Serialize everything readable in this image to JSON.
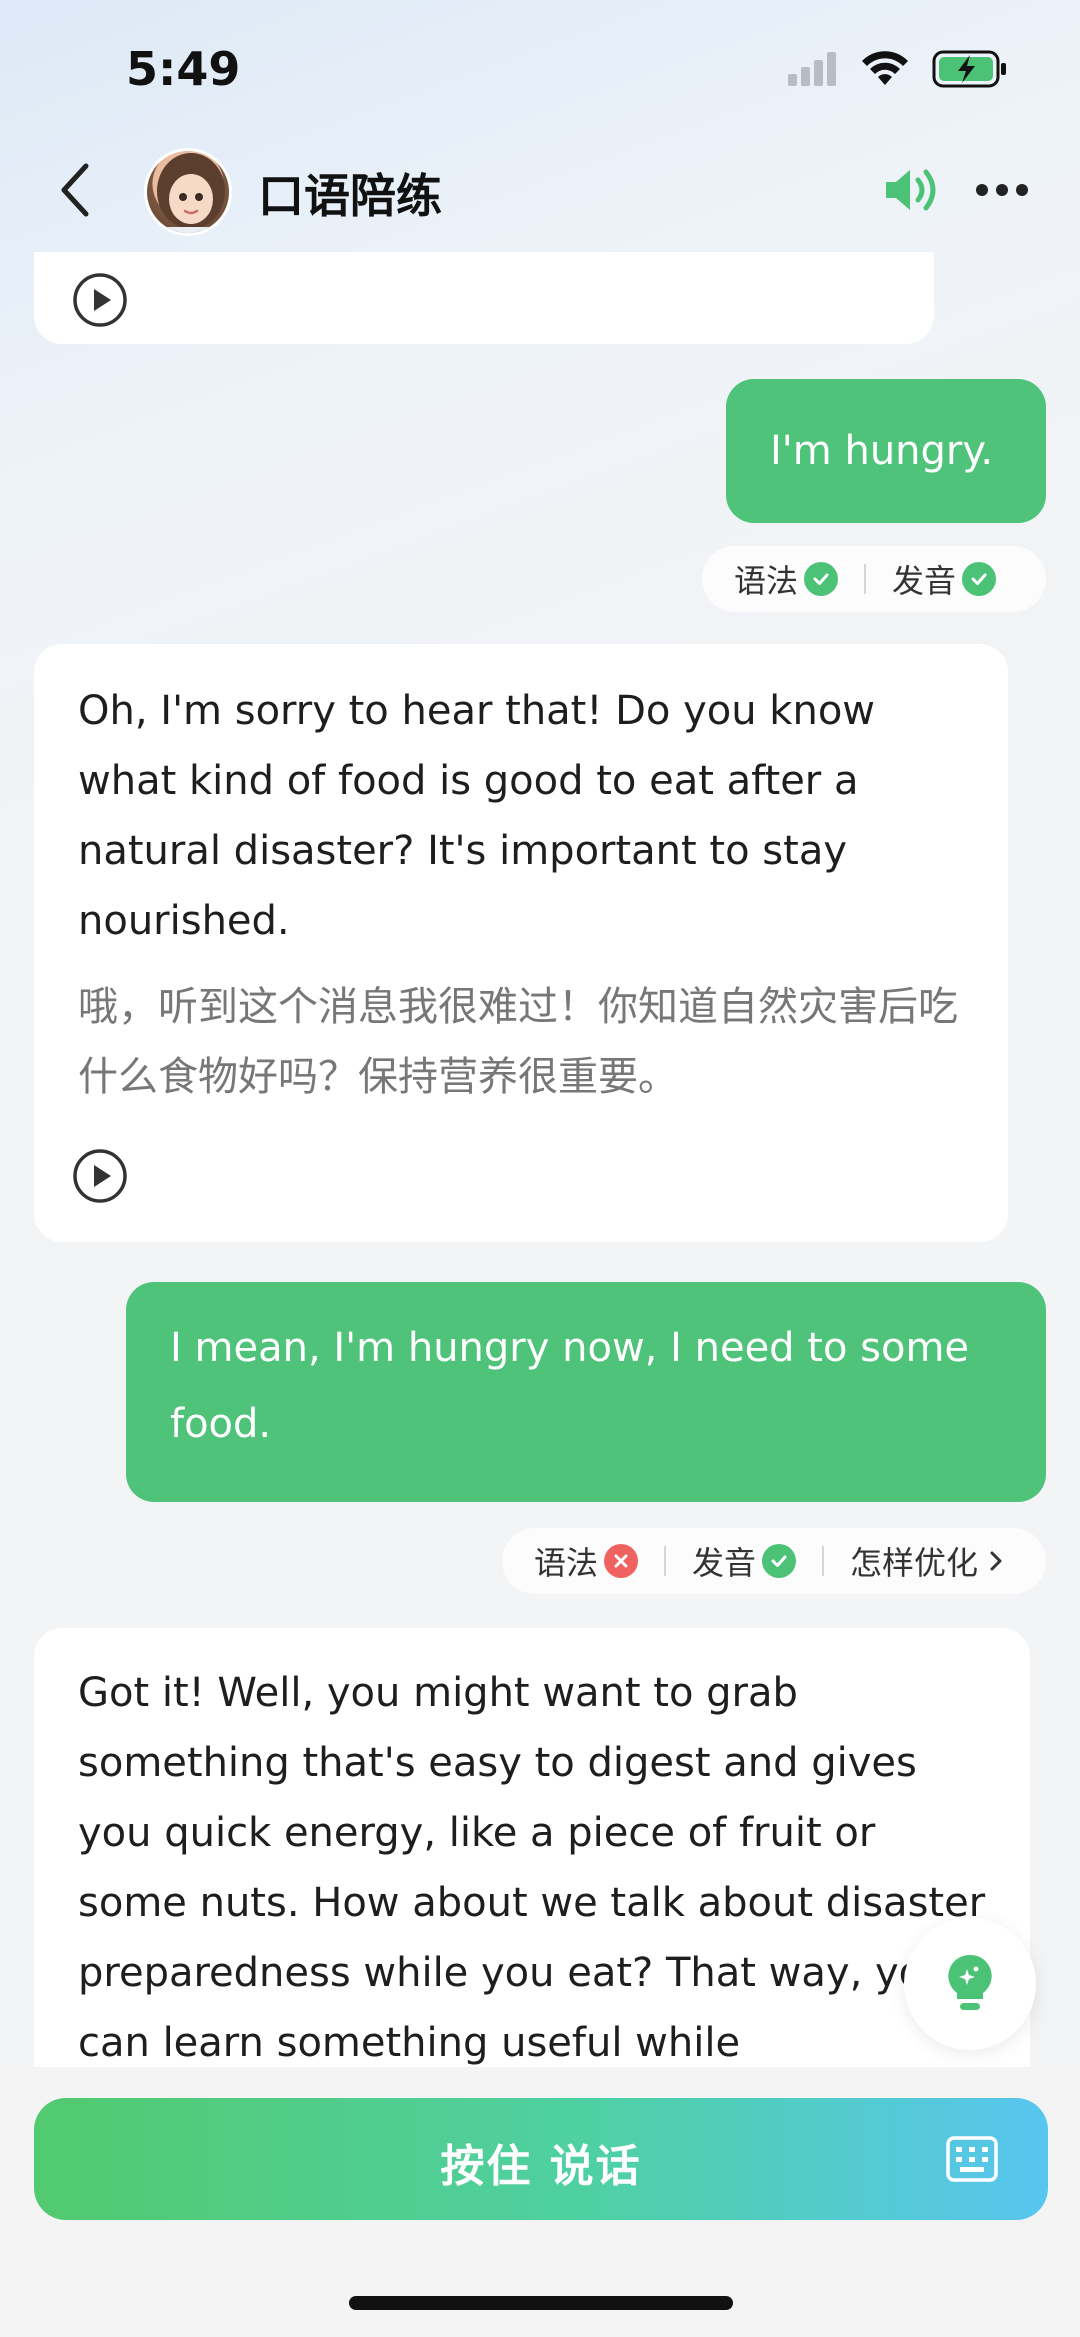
{
  "status_bar": {
    "time": "5:49"
  },
  "header": {
    "title": "口语陪练"
  },
  "messages": [
    {
      "role": "user",
      "text": "I'm hungry."
    },
    {
      "role": "ai",
      "text_en": "Oh, I'm sorry to hear that! Do you know what kind of food is good to eat after a natural disaster? It's important to stay nourished.",
      "text_zh": "哦，听到这个消息我很难过！你知道自然灾害后吃什么食物好吗？保持营养很重要。"
    },
    {
      "role": "user",
      "text": "I mean, I'm hungry now, I need to some food."
    },
    {
      "role": "ai",
      "text_en": "Got it! Well, you might want to grab something that's easy to digest and gives you quick energy, like a piece of fruit or some nuts. How about we talk about disaster preparedness while you eat? That way, you can learn something useful while"
    }
  ],
  "eval1": {
    "grammar": "语法",
    "pronunciation": "发音"
  },
  "eval2": {
    "grammar": "语法",
    "pronunciation": "发音",
    "optimize": "怎样优化"
  },
  "bottom": {
    "talk_label": "按住 说话"
  },
  "colors": {
    "accent_green": "#4fc37a",
    "error_red": "#f0625f"
  }
}
